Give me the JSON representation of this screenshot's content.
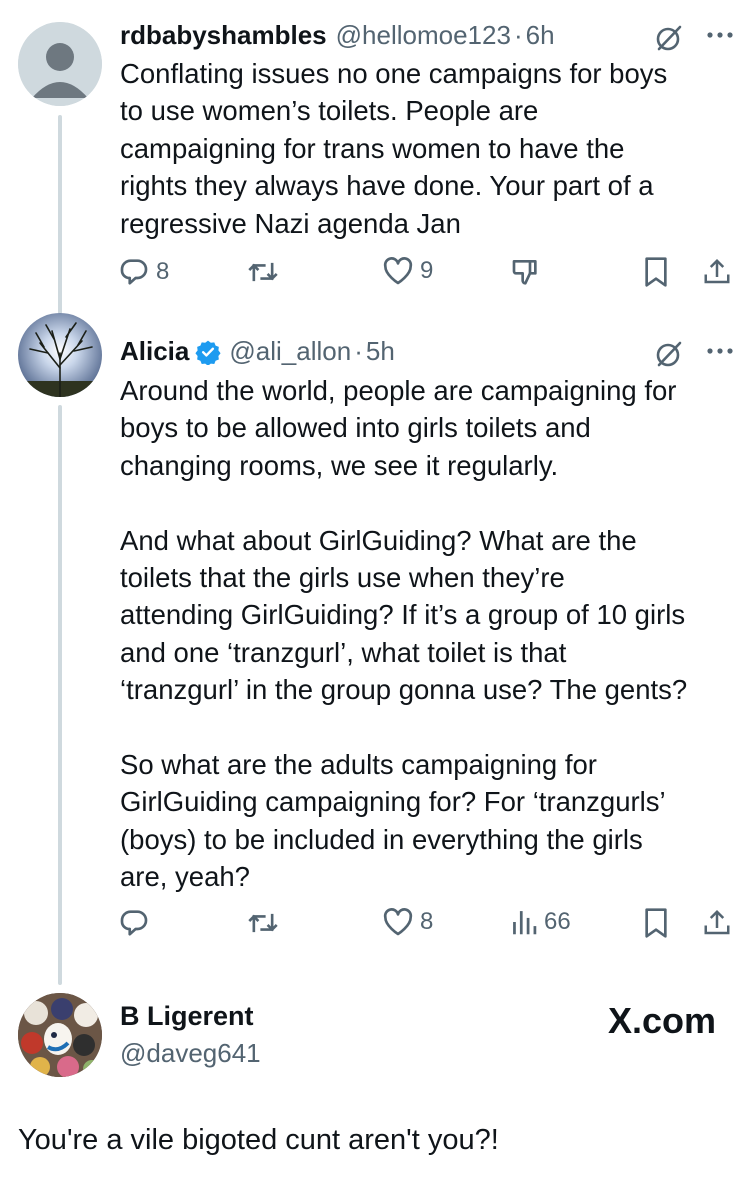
{
  "tweets": [
    {
      "display_name": "rdbabyshambles",
      "handle": "@hellomoe123",
      "separator": "·",
      "time": "6h",
      "verified": false,
      "text": "Conflating issues no one campaigns for boys\nto use women’s toilets. People are\ncampaigning for trans women to have the\nrights they always have done. Your part of a\nregressive Nazi agenda Jan",
      "actions": {
        "replies": "8",
        "reposts": "",
        "likes": "9",
        "dislike": true
      }
    },
    {
      "display_name": "Alicia",
      "handle": "@ali_allon",
      "separator": "·",
      "time": "5h",
      "verified": true,
      "text": "Around the world, people are campaigning for\nboys to be allowed into girls toilets and\nchanging rooms, we see it regularly.\n\nAnd what about GirlGuiding? What are the\ntoilets that the girls use when they’re\nattending GirlGuiding? If it’s a group of 10 girls\nand one ‘tranzgurl’, what toilet is that\n‘tranzgurl’ in the group gonna use? The gents?\n\nSo what are the adults campaigning for\nGirlGuiding campaigning for? For ‘tranzgurls’\n(boys) to be included in everything the girls\nare, yeah?",
      "actions": {
        "replies": "",
        "reposts": "",
        "likes": "8",
        "views": "66"
      }
    }
  ],
  "reply": {
    "display_name": "B Ligerent",
    "handle": "@daveg641",
    "text": "You're a vile bigoted cunt aren't you?!",
    "watermark": "X.com"
  },
  "colors": {
    "text": "#0f1419",
    "secondary": "#536471",
    "verified": "#1d9bf0",
    "thread_line": "#cfd9de"
  },
  "icons": [
    "reply-icon",
    "repost-icon",
    "like-icon",
    "dislike-icon",
    "views-icon",
    "bookmark-icon",
    "share-icon",
    "grok-icon",
    "more-icon",
    "verified-badge-icon"
  ]
}
